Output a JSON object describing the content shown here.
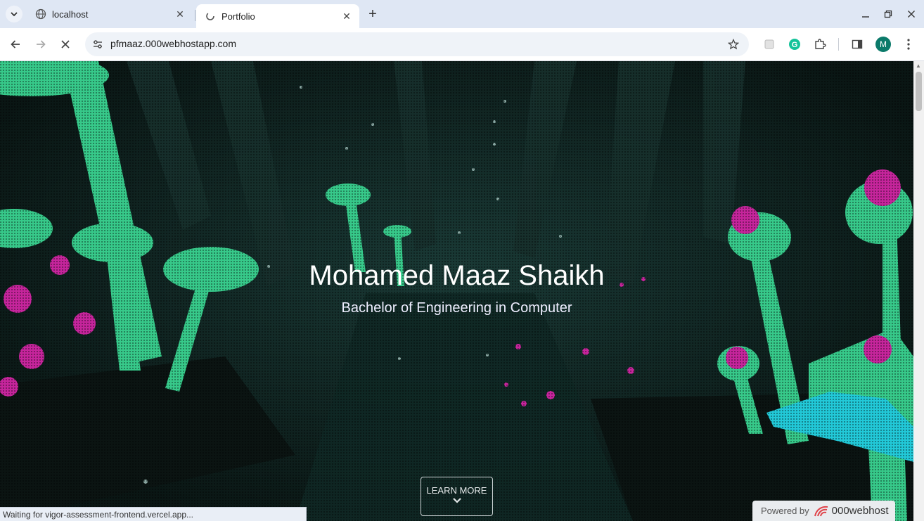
{
  "browser": {
    "tabs": [
      {
        "title": "localhost",
        "active": false
      },
      {
        "title": "Portfolio",
        "active": true
      }
    ],
    "url": "pfmaaz.000webhostapp.com",
    "profile_initial": "M"
  },
  "hero": {
    "name": "Mohamed Maaz Shaikh",
    "subtitle": "Bachelor of Engineering in Computer",
    "learn_more": "LEARN MORE"
  },
  "status_bar": "Waiting for vigor-assessment-frontend.vercel.app...",
  "powered_by": {
    "label": "Powered by",
    "brand": "000webhost"
  },
  "colors": {
    "accent_green": "#3fe08d",
    "accent_magenta": "#d42fa6",
    "background": "#0c1a18"
  }
}
